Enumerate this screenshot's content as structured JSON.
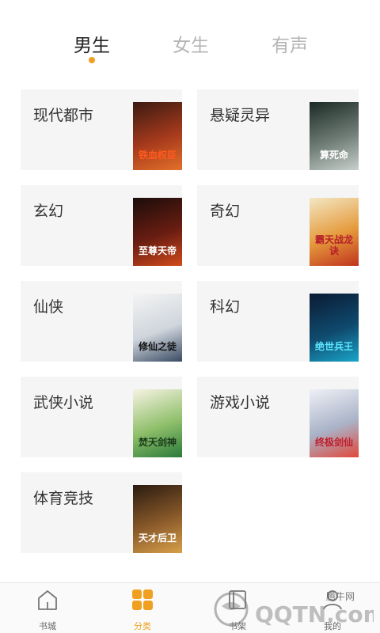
{
  "tabs": [
    {
      "label": "男生",
      "active": true
    },
    {
      "label": "女生",
      "active": false
    },
    {
      "label": "有声",
      "active": false
    }
  ],
  "categories": [
    {
      "label": "现代都市",
      "cover_text": "铁血权臣",
      "cover_colors": [
        "#3b1a12",
        "#a63a1c",
        "#e3702a"
      ],
      "text_color": "#ff5a1f"
    },
    {
      "label": "悬疑灵异",
      "cover_text": "算死命",
      "cover_colors": [
        "#1b2a24",
        "#6f7d76",
        "#c8d0cb"
      ],
      "text_color": "#ffffff"
    },
    {
      "label": "玄幻",
      "cover_text": "至尊天帝",
      "cover_colors": [
        "#1a0d0a",
        "#6a1d12",
        "#d24a1b"
      ],
      "text_color": "#ffffff"
    },
    {
      "label": "奇幻",
      "cover_text": "霸天战龙诀",
      "cover_colors": [
        "#f3e7c4",
        "#e59a3c",
        "#c0331d"
      ],
      "text_color": "#b8202a"
    },
    {
      "label": "仙侠",
      "cover_text": "修仙之徒",
      "cover_colors": [
        "#f4f4f4",
        "#cfd5dc",
        "#394a63"
      ],
      "text_color": "#111111"
    },
    {
      "label": "科幻",
      "cover_text": "绝世兵王",
      "cover_colors": [
        "#0b1b33",
        "#0f4a6e",
        "#1aa5c9"
      ],
      "text_color": "#5fe6ff"
    },
    {
      "label": "武侠小说",
      "cover_text": "焚天剑神",
      "cover_colors": [
        "#f7f3e3",
        "#8fbf6a",
        "#2a7a3a"
      ],
      "text_color": "#1a3a1a"
    },
    {
      "label": "游戏小说",
      "cover_text": "终极剑仙",
      "cover_colors": [
        "#eef0f5",
        "#a9b3c8",
        "#e0483c"
      ],
      "text_color": "#c01e2a"
    },
    {
      "label": "体育竞技",
      "cover_text": "天才后卫",
      "cover_colors": [
        "#2a1b10",
        "#8a5a2a",
        "#d8a04a"
      ],
      "text_color": "#ffffff"
    }
  ],
  "bottom_nav": [
    {
      "label": "书城",
      "icon": "home-icon",
      "active": false
    },
    {
      "label": "分类",
      "icon": "grid-icon",
      "active": true
    },
    {
      "label": "书架",
      "icon": "bookshelf-icon",
      "active": false
    },
    {
      "label": "我的",
      "icon": "user-icon",
      "active": false
    }
  ],
  "watermark": {
    "text_top": "腾牛网",
    "text_main": "QQTN.com"
  },
  "colors": {
    "accent": "#f0a020",
    "card_bg": "#f5f5f5",
    "tab_inactive": "#b5b5b5"
  }
}
